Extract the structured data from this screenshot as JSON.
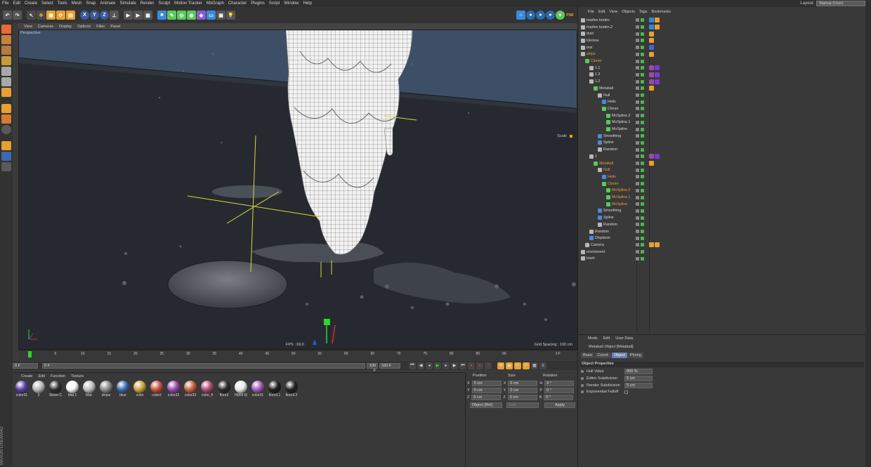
{
  "menubar": {
    "items": [
      "File",
      "Edit",
      "Create",
      "Select",
      "Tools",
      "Mesh",
      "Snap",
      "Animate",
      "Simulate",
      "Render",
      "Sculpt",
      "Motion Tracker",
      "MoGraph",
      "Character",
      "Plugins",
      "Script",
      "Window",
      "Help"
    ],
    "layout_label": "Layout:",
    "layout_value": "Startup (User)"
  },
  "toolbar": {
    "axis_x": "X",
    "axis_y": "Y",
    "axis_z": "Z"
  },
  "viewport": {
    "menu": [
      "View",
      "Cameras",
      "Display",
      "Options",
      "Filter",
      "Panel"
    ],
    "label": "Perspective",
    "scale_label": "Scale",
    "fps": "FPS : 69.0",
    "grid_spacing": "Grid Spacing : 100 cm"
  },
  "timeline": {
    "ticks": [
      "0",
      "5",
      "10",
      "15",
      "20",
      "25",
      "30",
      "35",
      "40",
      "45",
      "50",
      "55",
      "60",
      "65",
      "70",
      "75",
      "80",
      "85",
      "90"
    ],
    "current_frame_marker": "2",
    "end_label": "2 F",
    "start_field": "0 F",
    "min_field": "0 F",
    "slider_value": "100 F",
    "end_field": "100 F"
  },
  "materials": {
    "menu": [
      "Create",
      "Edit",
      "Function",
      "Texture"
    ],
    "items": [
      {
        "name": "color31",
        "color": "#5b3fa8"
      },
      {
        "name": "3",
        "color": "#b8b8b8"
      },
      {
        "name": "Stone C",
        "color": "#303030"
      },
      {
        "name": "Mat.1",
        "color": "#f4f4f4"
      },
      {
        "name": "Mat.",
        "color": "#c0c0c0"
      },
      {
        "name": "drops",
        "color": "#8a8a8a"
      },
      {
        "name": "blue",
        "color": "#3a6aa8"
      },
      {
        "name": "color",
        "color": "#c9a23a"
      },
      {
        "name": "color2",
        "color": "#c85040"
      },
      {
        "name": "color32",
        "color": "#9a4ab0"
      },
      {
        "name": "color33",
        "color": "#c8603a"
      },
      {
        "name": "color_fl",
        "color": "#b04a70"
      },
      {
        "name": "floor3",
        "color": "#2a2a2a"
      },
      {
        "name": "HDRI 0(",
        "color": "#e8e8e8"
      },
      {
        "name": "color31",
        "color": "#a05ab8"
      },
      {
        "name": "floor3.1",
        "color": "#1e1e1e"
      },
      {
        "name": "floor3.2",
        "color": "#222222"
      }
    ]
  },
  "coords": {
    "position": "Position",
    "size": "Size",
    "rotation": "Rotation",
    "rows": [
      {
        "axis": "X",
        "pos": "0 cm",
        "size_axis": "X",
        "size": "0 cm",
        "rot_axis": "H",
        "rot": "0 °"
      },
      {
        "axis": "Y",
        "pos": "0 cm",
        "size_axis": "Y",
        "size": "0 cm",
        "rot_axis": "P",
        "rot": "0 °"
      },
      {
        "axis": "Z",
        "pos": "0 cm",
        "size_axis": "Z",
        "size": "0 cm",
        "rot_axis": "B",
        "rot": "0 °"
      }
    ],
    "mode": "Object (Rel)",
    "size_mode": "Size",
    "apply": "Apply"
  },
  "objects": {
    "menu": [
      "File",
      "Edit",
      "View",
      "Objects",
      "Tags",
      "Bookmarks"
    ],
    "rows": [
      {
        "name": "tropfen boden",
        "indent": 0,
        "color": "#d8d8d8",
        "icon": "#b8b8b8",
        "tags": [
          "#2a8ad8",
          "#e8a030"
        ]
      },
      {
        "name": "tropfen boden.2",
        "indent": 0,
        "color": "#d8d8d8",
        "icon": "#b8b8b8",
        "tags": [
          "#2a8ad8",
          "#e8a030"
        ]
      },
      {
        "name": "dust",
        "indent": 0,
        "color": "#d8d8d8",
        "icon": "#b8b8b8",
        "tags": [
          "#e8a030"
        ]
      },
      {
        "name": "kleckse",
        "indent": 0,
        "color": "#d8d8d8",
        "icon": "#b8b8b8",
        "tags": [
          "#e8a030"
        ]
      },
      {
        "name": "test",
        "indent": 0,
        "color": "#d8d8d8",
        "icon": "#b8b8b8",
        "tags": [
          "#3a6ad8"
        ]
      },
      {
        "name": "strips",
        "indent": 0,
        "color": "#e8a030",
        "icon": "#b8b8b8",
        "tags": [
          "#e8a030"
        ]
      },
      {
        "name": "Cloner",
        "indent": 1,
        "color": "#e8a030",
        "icon": "#5aca5a",
        "tags": []
      },
      {
        "name": "1.1",
        "indent": 2,
        "color": "#d8d8d8",
        "icon": "#b8b8b8",
        "tags": [
          "#9a4ab0",
          "#7a3ad0"
        ]
      },
      {
        "name": "1.3",
        "indent": 2,
        "color": "#d8d8d8",
        "icon": "#b8b8b8",
        "tags": [
          "#9a4ab0",
          "#7a3ad0"
        ]
      },
      {
        "name": "1.2",
        "indent": 2,
        "color": "#d8d8d8",
        "icon": "#b8b8b8",
        "tags": [
          "#9a4ab0",
          "#7a3ad0"
        ]
      },
      {
        "name": "Metaball",
        "indent": 3,
        "color": "#d8d8d8",
        "icon": "#5aca5a",
        "tags": [
          "#e8a030"
        ]
      },
      {
        "name": "Null",
        "indent": 4,
        "color": "#d8d8d8",
        "icon": "#b8b8b8",
        "tags": []
      },
      {
        "name": "Helix",
        "indent": 5,
        "color": "#d8d8d8",
        "icon": "#4a8ad8",
        "tags": []
      },
      {
        "name": "Cloner",
        "indent": 5,
        "color": "#d8d8d8",
        "icon": "#5aca5a",
        "tags": []
      },
      {
        "name": "MoSpline.2",
        "indent": 6,
        "color": "#d8d8d8",
        "icon": "#5aca5a",
        "tags": []
      },
      {
        "name": "MoSpline.1",
        "indent": 6,
        "color": "#d8d8d8",
        "icon": "#5aca5a",
        "tags": []
      },
      {
        "name": "MoSpline",
        "indent": 6,
        "color": "#d8d8d8",
        "icon": "#5aca5a",
        "tags": []
      },
      {
        "name": "Smoothing",
        "indent": 4,
        "color": "#d8d8d8",
        "icon": "#4a8ad8",
        "tags": []
      },
      {
        "name": "Spline",
        "indent": 4,
        "color": "#d8d8d8",
        "icon": "#4a8ad8",
        "tags": []
      },
      {
        "name": "Random",
        "indent": 4,
        "color": "#d8d8d8",
        "icon": "#b8b8b8",
        "tags": []
      },
      {
        "name": "1",
        "indent": 2,
        "color": "#d8d8d8",
        "icon": "#b8b8b8",
        "tags": [
          "#9a4ab0",
          "#7a3ad0"
        ]
      },
      {
        "name": "Metaball",
        "indent": 3,
        "color": "#e8a030",
        "icon": "#5aca5a",
        "tags": [
          "#e8a030"
        ]
      },
      {
        "name": "Null",
        "indent": 4,
        "color": "#e8a030",
        "icon": "#b8b8b8",
        "tags": []
      },
      {
        "name": "Helix",
        "indent": 5,
        "color": "#e8a030",
        "icon": "#4a8ad8",
        "tags": []
      },
      {
        "name": "Cloner",
        "indent": 5,
        "color": "#e8a030",
        "icon": "#5aca5a",
        "tags": []
      },
      {
        "name": "MoSpline.2",
        "indent": 6,
        "color": "#e8a030",
        "icon": "#5aca5a",
        "tags": []
      },
      {
        "name": "MoSpline.1",
        "indent": 6,
        "color": "#e8a030",
        "icon": "#5aca5a",
        "tags": []
      },
      {
        "name": "MoSpline",
        "indent": 6,
        "color": "#e8a030",
        "icon": "#5aca5a",
        "tags": []
      },
      {
        "name": "Smoothing",
        "indent": 4,
        "color": "#d8d8d8",
        "icon": "#4a8ad8",
        "tags": []
      },
      {
        "name": "Spline",
        "indent": 4,
        "color": "#d8d8d8",
        "icon": "#4a8ad8",
        "tags": []
      },
      {
        "name": "Random",
        "indent": 4,
        "color": "#d8d8d8",
        "icon": "#b8b8b8",
        "tags": []
      },
      {
        "name": "Random",
        "indent": 2,
        "color": "#d8d8d8",
        "icon": "#b8b8b8",
        "tags": []
      },
      {
        "name": "Displacer",
        "indent": 2,
        "color": "#d8d8d8",
        "icon": "#4a8ad8",
        "tags": []
      },
      {
        "name": "Camera",
        "indent": 1,
        "color": "#d8d8d8",
        "icon": "#b8b8b8",
        "tags": [
          "#e8a030",
          "#e8a030"
        ]
      },
      {
        "name": "enviroment",
        "indent": 0,
        "color": "#d8d8d8",
        "icon": "#b8b8b8",
        "tags": []
      },
      {
        "name": "trash",
        "indent": 0,
        "color": "#d8d8d8",
        "icon": "#b8b8b8",
        "tags": []
      }
    ]
  },
  "attributes": {
    "menu": [
      "Mode",
      "Edit",
      "User Data"
    ],
    "title": "Metaball Object [Metaball]",
    "tabs": [
      "Basic",
      "Coord.",
      "Object",
      "Phong"
    ],
    "active_tab": "Object",
    "section": "Object Properties",
    "props": [
      {
        "label": "Hull Value",
        "value": "800 %"
      },
      {
        "label": "Editor Subdivision",
        "value": "5 cm"
      },
      {
        "label": "Render Subdivision",
        "value": "5 cm"
      },
      {
        "label": "Exponential Falloff",
        "value": ""
      }
    ]
  },
  "brand": "MAXON CINEMA4D"
}
